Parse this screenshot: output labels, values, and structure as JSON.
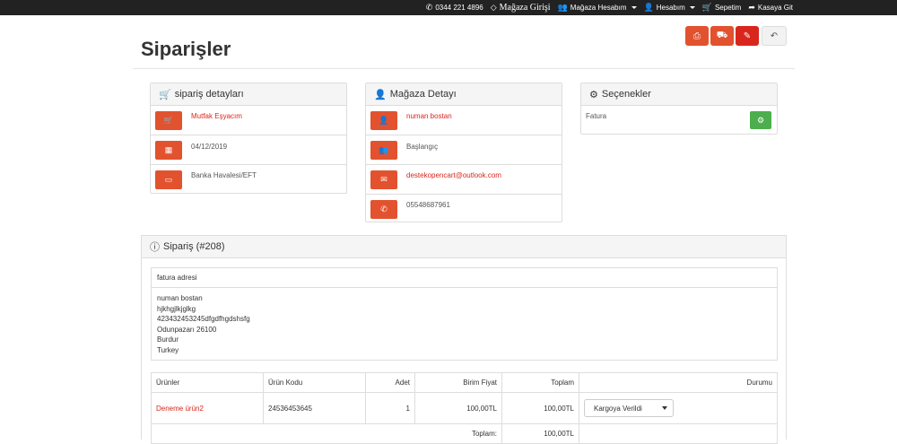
{
  "topbar": {
    "phone": "0344 221 4896",
    "store_login": "Mağaza Girişi",
    "store_account": "Mağaza Hesabım",
    "account": "Hesabım",
    "cart": "Sepetim",
    "checkout": "Kasaya Git"
  },
  "page": {
    "title": "Siparişler"
  },
  "order_details": {
    "heading": "sipariş detayları",
    "store": "Mutfak Eşyacım",
    "date": "04/12/2019",
    "payment": "Banka Havalesi/EFT"
  },
  "store_details": {
    "heading": "Mağaza Detayı",
    "name": "numan bostan",
    "group": "Başlangıç",
    "email": "destekopencart@outlook.com",
    "phone": "05548687961"
  },
  "options": {
    "heading": "Seçenekler",
    "invoice": "Fatura"
  },
  "order": {
    "heading": "Sipariş (#208)",
    "address_heading": "fatura adresi",
    "address_lines": [
      "numan bostan",
      "hjkhgjlkjglkg",
      "423432453245dfgdfhgdshsfg",
      "Odunpazarı 26100",
      "Burdur",
      "Turkey"
    ],
    "columns": {
      "products": "Ürünler",
      "code": "Ürün Kodu",
      "qty": "Adet",
      "unit_price": "Birim Fiyat",
      "total": "Toplam",
      "status": "Durumu"
    },
    "row": {
      "product": "Deneme ürün2",
      "code": "24536453645",
      "qty": "1",
      "unit_price": "100,00TL",
      "total": "100,00TL",
      "status": "Kargoya Verildi"
    },
    "subtotal_label": "Toplam:",
    "subtotal_value": "100,00TL"
  }
}
